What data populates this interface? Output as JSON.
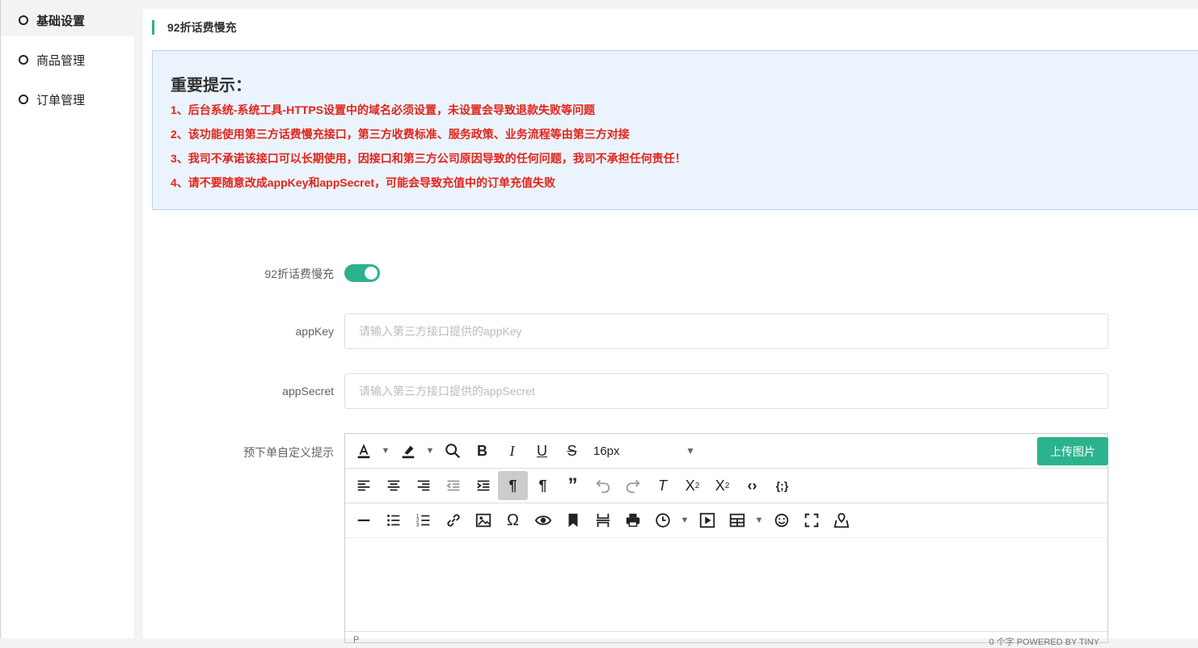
{
  "sidebar": {
    "items": [
      {
        "label": "基础设置"
      },
      {
        "label": "商品管理"
      },
      {
        "label": "订单管理"
      }
    ]
  },
  "page": {
    "title": "92折话费慢充"
  },
  "notice": {
    "heading": "重要提示：",
    "lines": [
      "1、后台系统-系统工具-HTTPS设置中的域名必须设置，未设置会导致退款失败等问题",
      "2、该功能使用第三方话费慢充接口，第三方收费标准、服务政策、业务流程等由第三方对接",
      "3、我司不承诺该接口可以长期使用，因接口和第三方公司原因导致的任何问题，我司不承担任何责任！",
      "4、请不要随意改成appKey和appSecret，可能会导致充值中的订单充值失败"
    ]
  },
  "form": {
    "toggle_label": "92折话费慢充",
    "toggle_on": true,
    "appkey_label": "appKey",
    "appkey_value": "",
    "appkey_placeholder": "请输入第三方接口提供的appKey",
    "appsecret_label": "appSecret",
    "appsecret_value": "",
    "appsecret_placeholder": "请输入第三方接口提供的appSecret",
    "editor_label": "预下单自定义提示"
  },
  "editor": {
    "font_size": "16px",
    "upload_label": "上传图片",
    "status_left": "P",
    "status_right": "0 个字  POWERED BY TINY"
  },
  "colors": {
    "accent": "#2bb38e",
    "notice_bg": "#ebf3fd",
    "notice_text": "#e1251b"
  }
}
